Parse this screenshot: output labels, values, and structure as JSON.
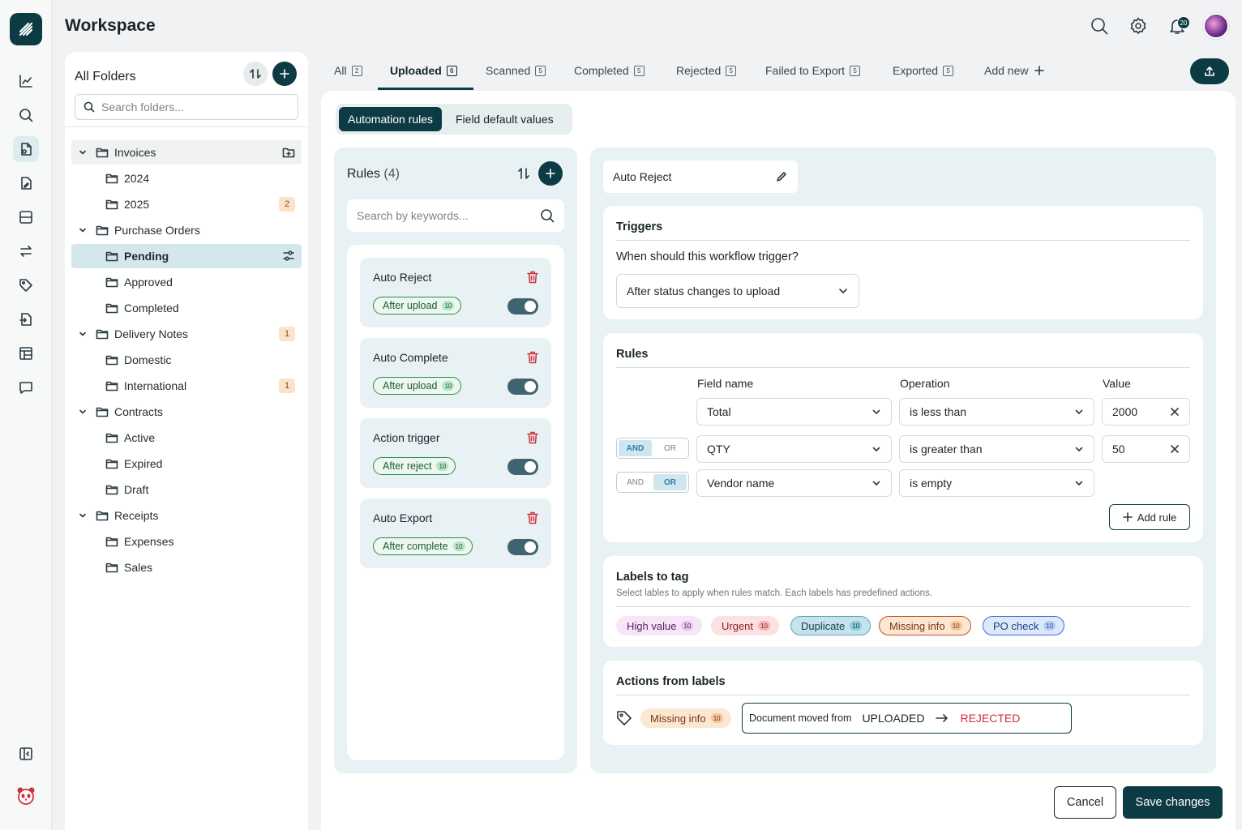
{
  "app": {
    "title": "Workspace"
  },
  "header": {
    "notification_count": "20"
  },
  "sidebar_icons": [
    "chart-icon",
    "search-icon",
    "document-icon",
    "document-edit-icon",
    "inbox-icon",
    "swap-icon",
    "tag-icon",
    "export-icon",
    "template-icon",
    "chat-icon"
  ],
  "folders": {
    "title": "All Folders",
    "search_placeholder": "Search folders...",
    "items": [
      {
        "label": "Invoices",
        "level": 0,
        "expanded": true
      },
      {
        "label": "2024",
        "level": 1
      },
      {
        "label": "2025",
        "level": 1,
        "badge": "2"
      },
      {
        "label": "Purchase Orders",
        "level": 0,
        "expanded": true
      },
      {
        "label": "Pending",
        "level": 1,
        "selected": true
      },
      {
        "label": "Approved",
        "level": 1
      },
      {
        "label": "Completed",
        "level": 1
      },
      {
        "label": "Delivery Notes",
        "level": 0,
        "expanded": true,
        "badge": "1"
      },
      {
        "label": "Domestic",
        "level": 1
      },
      {
        "label": "International",
        "level": 1,
        "badge": "1"
      },
      {
        "label": "Contracts",
        "level": 0,
        "expanded": true
      },
      {
        "label": "Active",
        "level": 1
      },
      {
        "label": "Expired",
        "level": 1
      },
      {
        "label": "Draft",
        "level": 1
      },
      {
        "label": "Receipts",
        "level": 0,
        "expanded": true
      },
      {
        "label": "Expenses",
        "level": 1
      },
      {
        "label": "Sales",
        "level": 1
      }
    ]
  },
  "tabs": [
    {
      "label": "All",
      "count": "2"
    },
    {
      "label": "Uploaded",
      "count": "6",
      "active": true
    },
    {
      "label": "Scanned",
      "count": "5"
    },
    {
      "label": "Completed",
      "count": "5"
    },
    {
      "label": "Rejected",
      "count": "5"
    },
    {
      "label": "Failed to Export",
      "count": "5"
    },
    {
      "label": "Exported",
      "count": "5"
    },
    {
      "label": "Add new",
      "count": ""
    }
  ],
  "subtabs": {
    "automation": "Automation rules",
    "defaults": "Field default values"
  },
  "rules": {
    "title": "Rules",
    "count": "(4)",
    "search_placeholder": "Search by keywords...",
    "items": [
      {
        "name": "Auto Reject",
        "trigger": "After upload",
        "count": "10",
        "enabled": true
      },
      {
        "name": "Auto Complete",
        "trigger": "After upload",
        "count": "10",
        "enabled": true
      },
      {
        "name": "Action trigger",
        "trigger": "After reject",
        "count": "10",
        "enabled": true
      },
      {
        "name": "Auto Export",
        "trigger": "After complete",
        "count": "10",
        "enabled": true
      }
    ]
  },
  "detail": {
    "rule_name": "Auto Reject",
    "triggers": {
      "title": "Triggers",
      "question": "When should this workflow trigger?",
      "selected": "After status changes to upload"
    },
    "rules_section": {
      "title": "Rules",
      "col_field": "Field name",
      "col_operation": "Operation",
      "col_value": "Value",
      "and_label": "AND",
      "or_label": "OR",
      "rows": [
        {
          "field": "Total",
          "operation": "is less than",
          "value": "2000",
          "connector": ""
        },
        {
          "field": "QTY",
          "operation": "is greater than",
          "value": "50",
          "connector": "AND"
        },
        {
          "field": "Vendor name",
          "operation": "is empty",
          "value": "",
          "connector": "OR"
        }
      ],
      "add_rule": "Add rule"
    },
    "labels": {
      "title": "Labels to tag",
      "description": "Select lables to apply when rules match. Each labels has predefined actions.",
      "items": [
        {
          "label": "High value",
          "count": "10",
          "bg": "#f6e6f8",
          "border": "#f6e6f8",
          "fg": "#5a2266",
          "badge": "#e7c4ee"
        },
        {
          "label": "Urgent",
          "count": "10",
          "bg": "#fbe1e1",
          "border": "#fbe1e1",
          "fg": "#8a1f1f",
          "badge": "#f2b6b6"
        },
        {
          "label": "Duplicate",
          "count": "10",
          "bg": "#c6e2ea",
          "border": "#5aa6bd",
          "fg": "#12424f",
          "badge": "#8fcbdc"
        },
        {
          "label": "Missing info",
          "count": "10",
          "bg": "#fbe7d2",
          "border": "#c0521f",
          "fg": "#7a3410",
          "badge": "#f3c79b"
        },
        {
          "label": "PO check",
          "count": "10",
          "bg": "#dde9fb",
          "border": "#3a6fd8",
          "fg": "#1d3f86",
          "badge": "#b4cdf5"
        }
      ]
    },
    "actions": {
      "title": "Actions from labels",
      "label": "Missing info",
      "label_count": "10",
      "moved_text": "Document moved from",
      "from": "UPLOADED",
      "to": "REJECTED"
    }
  },
  "footer": {
    "cancel": "Cancel",
    "save": "Save changes"
  },
  "colors": {
    "primary": "#0d3b44",
    "accent_light": "#e8f2f4",
    "danger": "#d0303a"
  }
}
